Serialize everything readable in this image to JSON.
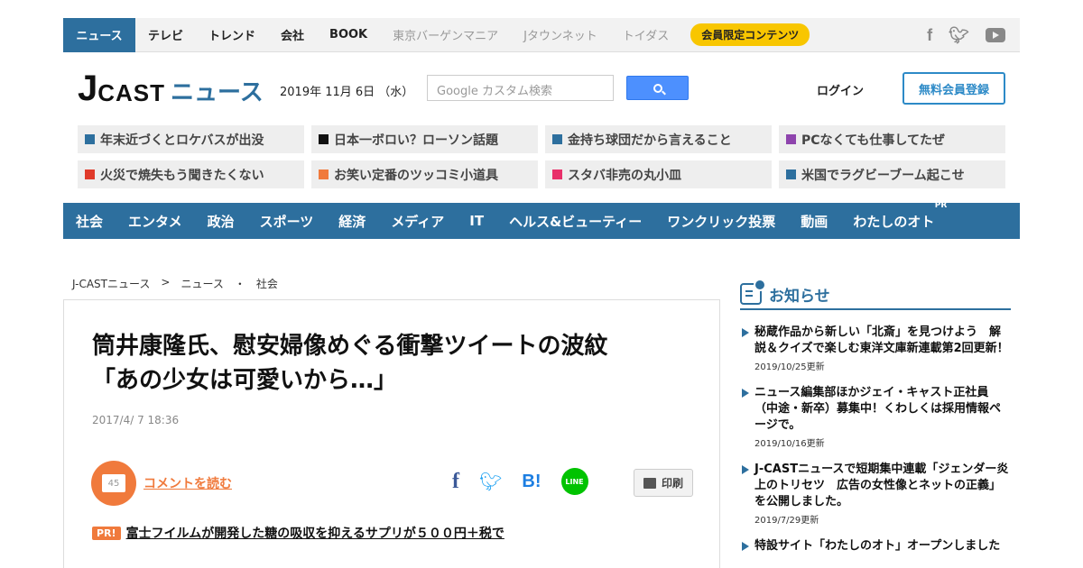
{
  "topnav": {
    "items": [
      {
        "label": "ニュース",
        "active": true
      },
      {
        "label": "テレビ"
      },
      {
        "label": "トレンド"
      },
      {
        "label": "会社"
      },
      {
        "label": "BOOK"
      },
      {
        "label": "東京バーゲンマニア"
      },
      {
        "label": "Jタウンネット"
      },
      {
        "label": "トイダス"
      }
    ],
    "member_badge": "会員限定コンテンツ",
    "social": [
      "facebook-icon",
      "twitter-icon",
      "youtube-icon"
    ]
  },
  "header": {
    "logo_j": "J",
    "logo_cast": "CAST",
    "logo_news": "ニュース",
    "date": "2019年 11月 6日 （水）",
    "search_placeholder": "Google カスタム検索",
    "login": "ログイン",
    "register": "無料会員登録"
  },
  "trending": [
    {
      "label": "年末近づくとロケバスが出没",
      "color": "#2d6f9e"
    },
    {
      "label": "日本一ボロい？ローソン話題",
      "color": "#111111"
    },
    {
      "label": "金持ち球団だから言えること",
      "color": "#2d6f9e"
    },
    {
      "label": "PCなくても仕事してたぜ",
      "color": "#8e44ad"
    },
    {
      "label": "火災で焼失もう聞きたくない",
      "color": "#e03a2a"
    },
    {
      "label": "お笑い定番のツッコミ小道具",
      "color": "#f07a3c"
    },
    {
      "label": "スタバ非売の丸小皿",
      "color": "#e8306a"
    },
    {
      "label": "米国でラグビーブーム起こせ",
      "color": "#2d6f9e"
    }
  ],
  "categories": [
    "社会",
    "エンタメ",
    "政治",
    "スポーツ",
    "経済",
    "メディア",
    "IT",
    "ヘルス&ビューティー",
    "ワンクリック投票",
    "動画",
    "わたしのオト"
  ],
  "category_pr": "PR",
  "breadcrumb": [
    "J-CASTニュース",
    ">",
    "ニュース",
    "・",
    "社会"
  ],
  "article": {
    "title_line1": "筒井康隆氏、慰安婦像めぐる衝撃ツイートの波紋",
    "title_line2": "「あの少女は可愛いから…」",
    "date": "2017/4/ 7 18:36",
    "comment_count": "45",
    "read_comments": "コメントを読む",
    "share_fb": "f",
    "share_hb": "B!",
    "share_line": "LINE",
    "print": "印刷",
    "pr_badge": "PR!",
    "pr_text": "富士フイルムが開発した糖の吸収を抑えるサプリが５００円＋税で"
  },
  "sidebar": {
    "title": "お知らせ",
    "notices": [
      {
        "text": "秘蔵作品から新しい「北斎」を見つけよう　解説＆クイズで楽しむ東洋文庫新連載第2回更新！",
        "date": "2019/10/25更新"
      },
      {
        "text": "ニュース編集部ほかジェイ・キャスト正社員（中途・新卒）募集中！くわしくは採用情報ページで。",
        "date": "2019/10/16更新"
      },
      {
        "text": "J-CASTニュースで短期集中連載「ジェンダー炎上のトリセツ　広告の女性像とネットの正義」を公開しました。",
        "date": "2019/7/29更新"
      },
      {
        "text": "特設サイト「わたしのオト」オープンしました",
        "date": ""
      }
    ]
  }
}
